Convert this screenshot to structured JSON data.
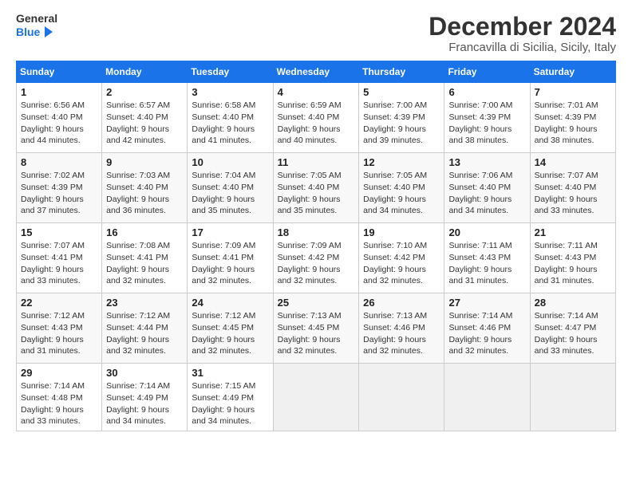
{
  "header": {
    "logo_general": "General",
    "logo_blue": "Blue",
    "month_title": "December 2024",
    "location": "Francavilla di Sicilia, Sicily, Italy"
  },
  "days_of_week": [
    "Sunday",
    "Monday",
    "Tuesday",
    "Wednesday",
    "Thursday",
    "Friday",
    "Saturday"
  ],
  "weeks": [
    [
      {
        "day": 1,
        "sunrise": "6:56 AM",
        "sunset": "4:40 PM",
        "daylight": "9 hours and 44 minutes."
      },
      {
        "day": 2,
        "sunrise": "6:57 AM",
        "sunset": "4:40 PM",
        "daylight": "9 hours and 42 minutes."
      },
      {
        "day": 3,
        "sunrise": "6:58 AM",
        "sunset": "4:40 PM",
        "daylight": "9 hours and 41 minutes."
      },
      {
        "day": 4,
        "sunrise": "6:59 AM",
        "sunset": "4:40 PM",
        "daylight": "9 hours and 40 minutes."
      },
      {
        "day": 5,
        "sunrise": "7:00 AM",
        "sunset": "4:39 PM",
        "daylight": "9 hours and 39 minutes."
      },
      {
        "day": 6,
        "sunrise": "7:00 AM",
        "sunset": "4:39 PM",
        "daylight": "9 hours and 38 minutes."
      },
      {
        "day": 7,
        "sunrise": "7:01 AM",
        "sunset": "4:39 PM",
        "daylight": "9 hours and 38 minutes."
      }
    ],
    [
      {
        "day": 8,
        "sunrise": "7:02 AM",
        "sunset": "4:39 PM",
        "daylight": "9 hours and 37 minutes."
      },
      {
        "day": 9,
        "sunrise": "7:03 AM",
        "sunset": "4:40 PM",
        "daylight": "9 hours and 36 minutes."
      },
      {
        "day": 10,
        "sunrise": "7:04 AM",
        "sunset": "4:40 PM",
        "daylight": "9 hours and 35 minutes."
      },
      {
        "day": 11,
        "sunrise": "7:05 AM",
        "sunset": "4:40 PM",
        "daylight": "9 hours and 35 minutes."
      },
      {
        "day": 12,
        "sunrise": "7:05 AM",
        "sunset": "4:40 PM",
        "daylight": "9 hours and 34 minutes."
      },
      {
        "day": 13,
        "sunrise": "7:06 AM",
        "sunset": "4:40 PM",
        "daylight": "9 hours and 34 minutes."
      },
      {
        "day": 14,
        "sunrise": "7:07 AM",
        "sunset": "4:40 PM",
        "daylight": "9 hours and 33 minutes."
      }
    ],
    [
      {
        "day": 15,
        "sunrise": "7:07 AM",
        "sunset": "4:41 PM",
        "daylight": "9 hours and 33 minutes."
      },
      {
        "day": 16,
        "sunrise": "7:08 AM",
        "sunset": "4:41 PM",
        "daylight": "9 hours and 32 minutes."
      },
      {
        "day": 17,
        "sunrise": "7:09 AM",
        "sunset": "4:41 PM",
        "daylight": "9 hours and 32 minutes."
      },
      {
        "day": 18,
        "sunrise": "7:09 AM",
        "sunset": "4:42 PM",
        "daylight": "9 hours and 32 minutes."
      },
      {
        "day": 19,
        "sunrise": "7:10 AM",
        "sunset": "4:42 PM",
        "daylight": "9 hours and 32 minutes."
      },
      {
        "day": 20,
        "sunrise": "7:11 AM",
        "sunset": "4:43 PM",
        "daylight": "9 hours and 31 minutes."
      },
      {
        "day": 21,
        "sunrise": "7:11 AM",
        "sunset": "4:43 PM",
        "daylight": "9 hours and 31 minutes."
      }
    ],
    [
      {
        "day": 22,
        "sunrise": "7:12 AM",
        "sunset": "4:43 PM",
        "daylight": "9 hours and 31 minutes."
      },
      {
        "day": 23,
        "sunrise": "7:12 AM",
        "sunset": "4:44 PM",
        "daylight": "9 hours and 32 minutes."
      },
      {
        "day": 24,
        "sunrise": "7:12 AM",
        "sunset": "4:45 PM",
        "daylight": "9 hours and 32 minutes."
      },
      {
        "day": 25,
        "sunrise": "7:13 AM",
        "sunset": "4:45 PM",
        "daylight": "9 hours and 32 minutes."
      },
      {
        "day": 26,
        "sunrise": "7:13 AM",
        "sunset": "4:46 PM",
        "daylight": "9 hours and 32 minutes."
      },
      {
        "day": 27,
        "sunrise": "7:14 AM",
        "sunset": "4:46 PM",
        "daylight": "9 hours and 32 minutes."
      },
      {
        "day": 28,
        "sunrise": "7:14 AM",
        "sunset": "4:47 PM",
        "daylight": "9 hours and 33 minutes."
      }
    ],
    [
      {
        "day": 29,
        "sunrise": "7:14 AM",
        "sunset": "4:48 PM",
        "daylight": "9 hours and 33 minutes."
      },
      {
        "day": 30,
        "sunrise": "7:14 AM",
        "sunset": "4:49 PM",
        "daylight": "9 hours and 34 minutes."
      },
      {
        "day": 31,
        "sunrise": "7:15 AM",
        "sunset": "4:49 PM",
        "daylight": "9 hours and 34 minutes."
      },
      null,
      null,
      null,
      null
    ]
  ]
}
